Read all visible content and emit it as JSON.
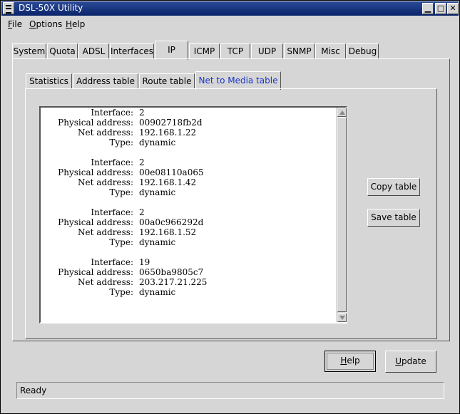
{
  "window": {
    "title": "DSL-50X Utility",
    "controls": {
      "minimize": "▁",
      "maximize": "□",
      "close": "✕"
    }
  },
  "menu": {
    "items": [
      {
        "label_first": "F",
        "label_rest": "ile"
      },
      {
        "label_first": "O",
        "label_rest": "ptions"
      },
      {
        "label_first": "H",
        "label_rest": "elp"
      }
    ]
  },
  "outer_tabs": [
    "System",
    "Quota",
    "ADSL",
    "Interfaces",
    "IP",
    "ICMP",
    "TCP",
    "UDP",
    "SNMP",
    "Misc",
    "Debug"
  ],
  "outer_active": "IP",
  "inner_tabs": [
    "Statistics",
    "Address table",
    "Route table",
    "Net to Media table"
  ],
  "inner_active": "Net to Media table",
  "table": {
    "keys": {
      "interface": "Interface:",
      "physical": "Physical address:",
      "net": "Net address:",
      "type": "Type:"
    },
    "entries": [
      {
        "interface": "2",
        "physical": "00902718fb2d",
        "net": "192.168.1.22",
        "type": "dynamic"
      },
      {
        "interface": "2",
        "physical": "00e08110a065",
        "net": "192.168.1.42",
        "type": "dynamic"
      },
      {
        "interface": "2",
        "physical": "00a0c966292d",
        "net": "192.168.1.52",
        "type": "dynamic"
      },
      {
        "interface": "19",
        "physical": "0650ba9805c7",
        "net": "203.217.21.225",
        "type": "dynamic"
      }
    ]
  },
  "buttons": {
    "copy_table": "Copy table",
    "save_table": "Save table",
    "help_first": "H",
    "help_rest": "elp",
    "update_first": "U",
    "update_rest": "pdate"
  },
  "status": {
    "text": "Ready"
  },
  "colors": {
    "titlebar": "#0a246a",
    "active_inner_tab_text": "#1a36c8",
    "background": "#d6d6d6"
  }
}
